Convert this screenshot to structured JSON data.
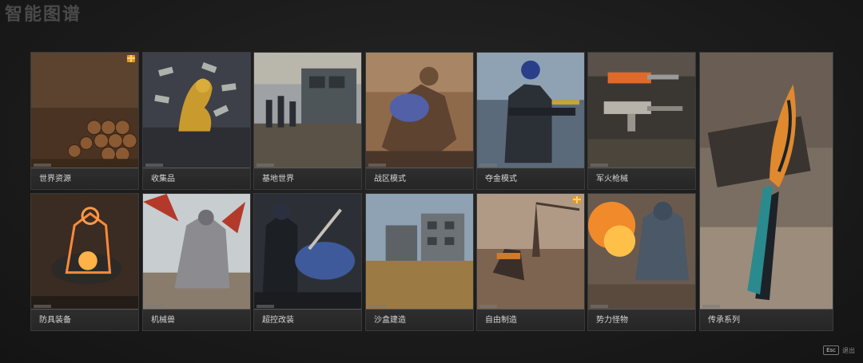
{
  "page": {
    "title": "智能图谱"
  },
  "cards": [
    {
      "label": "世界资源",
      "gift": true
    },
    {
      "label": "收集品",
      "gift": false
    },
    {
      "label": "基地世界",
      "gift": false
    },
    {
      "label": "战区模式",
      "gift": false
    },
    {
      "label": "夺金模式",
      "gift": false
    },
    {
      "label": "军火枪械",
      "gift": false
    },
    {
      "label": "传承系列",
      "gift": false
    },
    {
      "label": "防具装备",
      "gift": false
    },
    {
      "label": "机械兽",
      "gift": false
    },
    {
      "label": "超控改装",
      "gift": false
    },
    {
      "label": "沙盒建造",
      "gift": false
    },
    {
      "label": "自由制造",
      "gift": true
    },
    {
      "label": "势力怪物",
      "gift": false
    }
  ],
  "footer": {
    "esc_key": "Esc",
    "exit_label": "退出"
  },
  "colors": {
    "accent_gift": "#e49a1c",
    "card_border": "#3a3a3a",
    "background": "#1b1b1b"
  }
}
